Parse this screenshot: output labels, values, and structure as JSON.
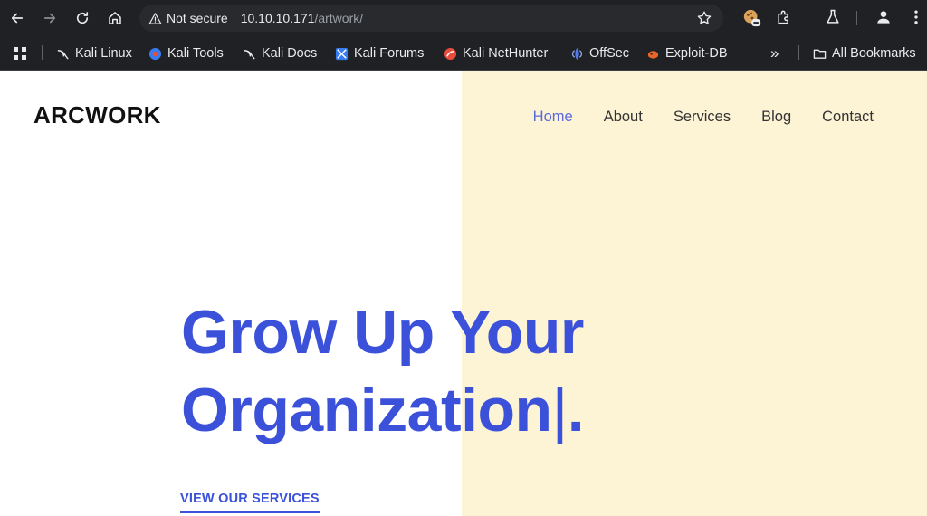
{
  "browser": {
    "security_label": "Not secure",
    "url_host": "10.10.10.171",
    "url_path": "/artwork/",
    "bookmarks": [
      {
        "label": "Kali Linux",
        "icon": "kali-icon"
      },
      {
        "label": "Kali Tools",
        "icon": "kali-tools-icon"
      },
      {
        "label": "Kali Docs",
        "icon": "kali-icon"
      },
      {
        "label": "Kali Forums",
        "icon": "kali-forums-icon"
      },
      {
        "label": "Kali NetHunter",
        "icon": "nethunter-icon"
      },
      {
        "label": "OffSec",
        "icon": "offsec-icon"
      },
      {
        "label": "Exploit-DB",
        "icon": "exploit-db-icon"
      }
    ],
    "overflow_label": "»",
    "all_bookmarks_label": "All Bookmarks"
  },
  "site": {
    "logo": "ARCWORK",
    "nav": [
      {
        "label": "Home",
        "active": true
      },
      {
        "label": "About"
      },
      {
        "label": "Services"
      },
      {
        "label": "Blog"
      },
      {
        "label": "Contact"
      }
    ],
    "hero_line1": "Grow Up Your",
    "hero_line2": "Organization",
    "hero_caret": "|",
    "hero_period": ".",
    "cta_label": "VIEW OUR SERVICES",
    "colors": {
      "accent": "#3b51d9",
      "panel": "#fdf3d5",
      "nav_active": "#5a6bd9"
    }
  }
}
